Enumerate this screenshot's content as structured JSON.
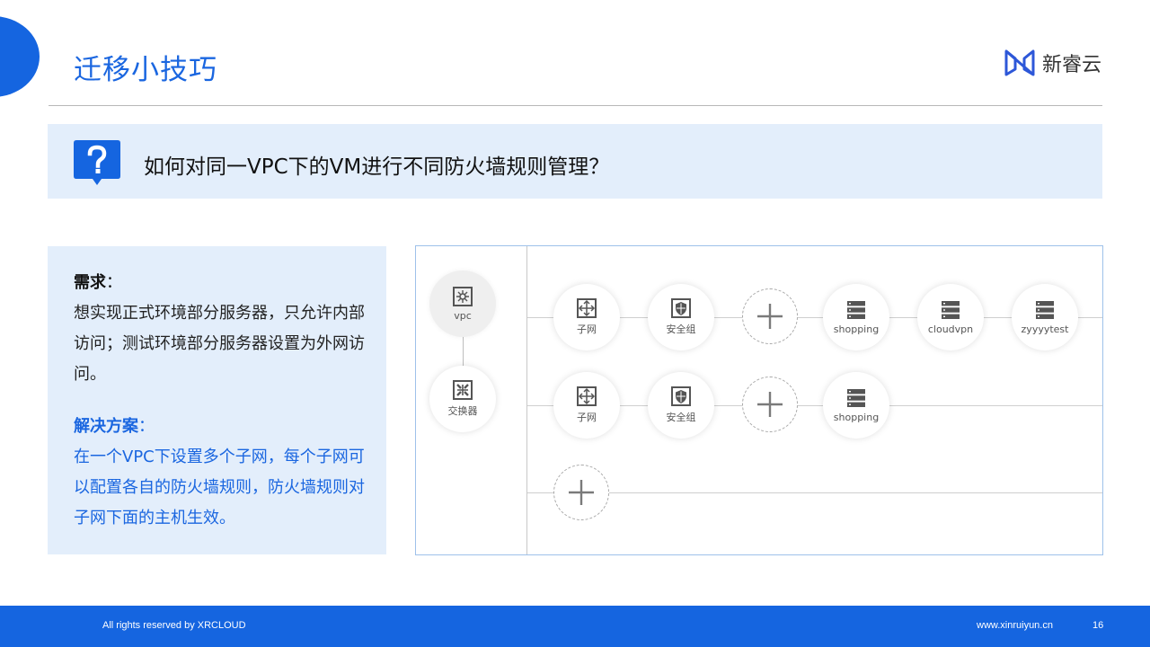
{
  "header": {
    "title": "迁移小技巧",
    "brand_name": "新睿云"
  },
  "question": {
    "text": "如何对同一VPC下的VM进行不同防火墙规则管理？"
  },
  "requirement": {
    "heading": "需求",
    "colon": "：",
    "body": "想实现正式环境部分服务器，只允许内部访问；测试环境部分服务器设置为外网访问。"
  },
  "solution": {
    "heading": "解决方案",
    "colon": "：",
    "body": "在一个VPC下设置多个子网，每个子网可以配置各自的防火墙规则，防火墙规则对子网下面的主机生效。"
  },
  "diagram": {
    "vpc_label": "vpc",
    "switch_label": "交换器",
    "row1": {
      "subnet_label": "子网",
      "security_group_label": "安全组",
      "hosts": [
        "shopping",
        "cloudvpn",
        "zyyyytest"
      ]
    },
    "row2": {
      "subnet_label": "子网",
      "security_group_label": "安全组",
      "hosts": [
        "shopping"
      ]
    }
  },
  "footer": {
    "copyright": "All rights reserved by XRCLOUD",
    "website": "www.xinruiyun.cn",
    "page_number": "16"
  },
  "colors": {
    "accent": "#1565e0",
    "panel_background": "#e3eefb",
    "title_blue": "#1a66e0"
  }
}
